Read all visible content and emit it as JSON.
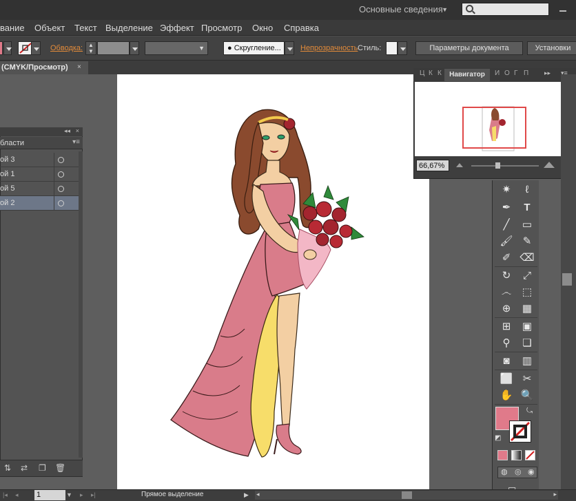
{
  "titlebar": {
    "workspace_label": "Основные сведения",
    "search_placeholder": ""
  },
  "menu": {
    "items": [
      {
        "label": "вание"
      },
      {
        "label": "Объект"
      },
      {
        "label": "Текст"
      },
      {
        "label": "Выделение"
      },
      {
        "label": "Эффект"
      },
      {
        "label": "Просмотр"
      },
      {
        "label": "Окно"
      },
      {
        "label": "Справка"
      }
    ]
  },
  "controlbar": {
    "stroke_label": "Обводка:",
    "brush_label": "Скругление...",
    "opacity_label": "Непрозрачность",
    "style_label": "Стиль:",
    "doc_settings_label": "Параметры документа",
    "prefs_label": "Установки"
  },
  "document": {
    "tab_title": "(CMYK/Просмотр)",
    "tab_close": "×"
  },
  "layers": {
    "tab_label": "бласти",
    "rows": [
      {
        "label": "ой 3"
      },
      {
        "label": "ой 1"
      },
      {
        "label": "ой 5"
      },
      {
        "label": "ой 2"
      }
    ]
  },
  "navigator": {
    "tabs_left": [
      "Ц",
      "К",
      "К"
    ],
    "active_tab": "Навигатор",
    "tabs_right": [
      "И",
      "О",
      "Г",
      "П"
    ],
    "zoom": "66,67%"
  },
  "statusbar": {
    "page": "1",
    "tool_name": "Прямое выделение"
  },
  "colors": {
    "fill": "#e07a8a",
    "accent_orange": "#e38b3a",
    "dress_pink": "#d97c8a",
    "dress_yellow": "#f7dd6a",
    "hair": "#8a4a2e",
    "skin": "#f3cfa3"
  }
}
